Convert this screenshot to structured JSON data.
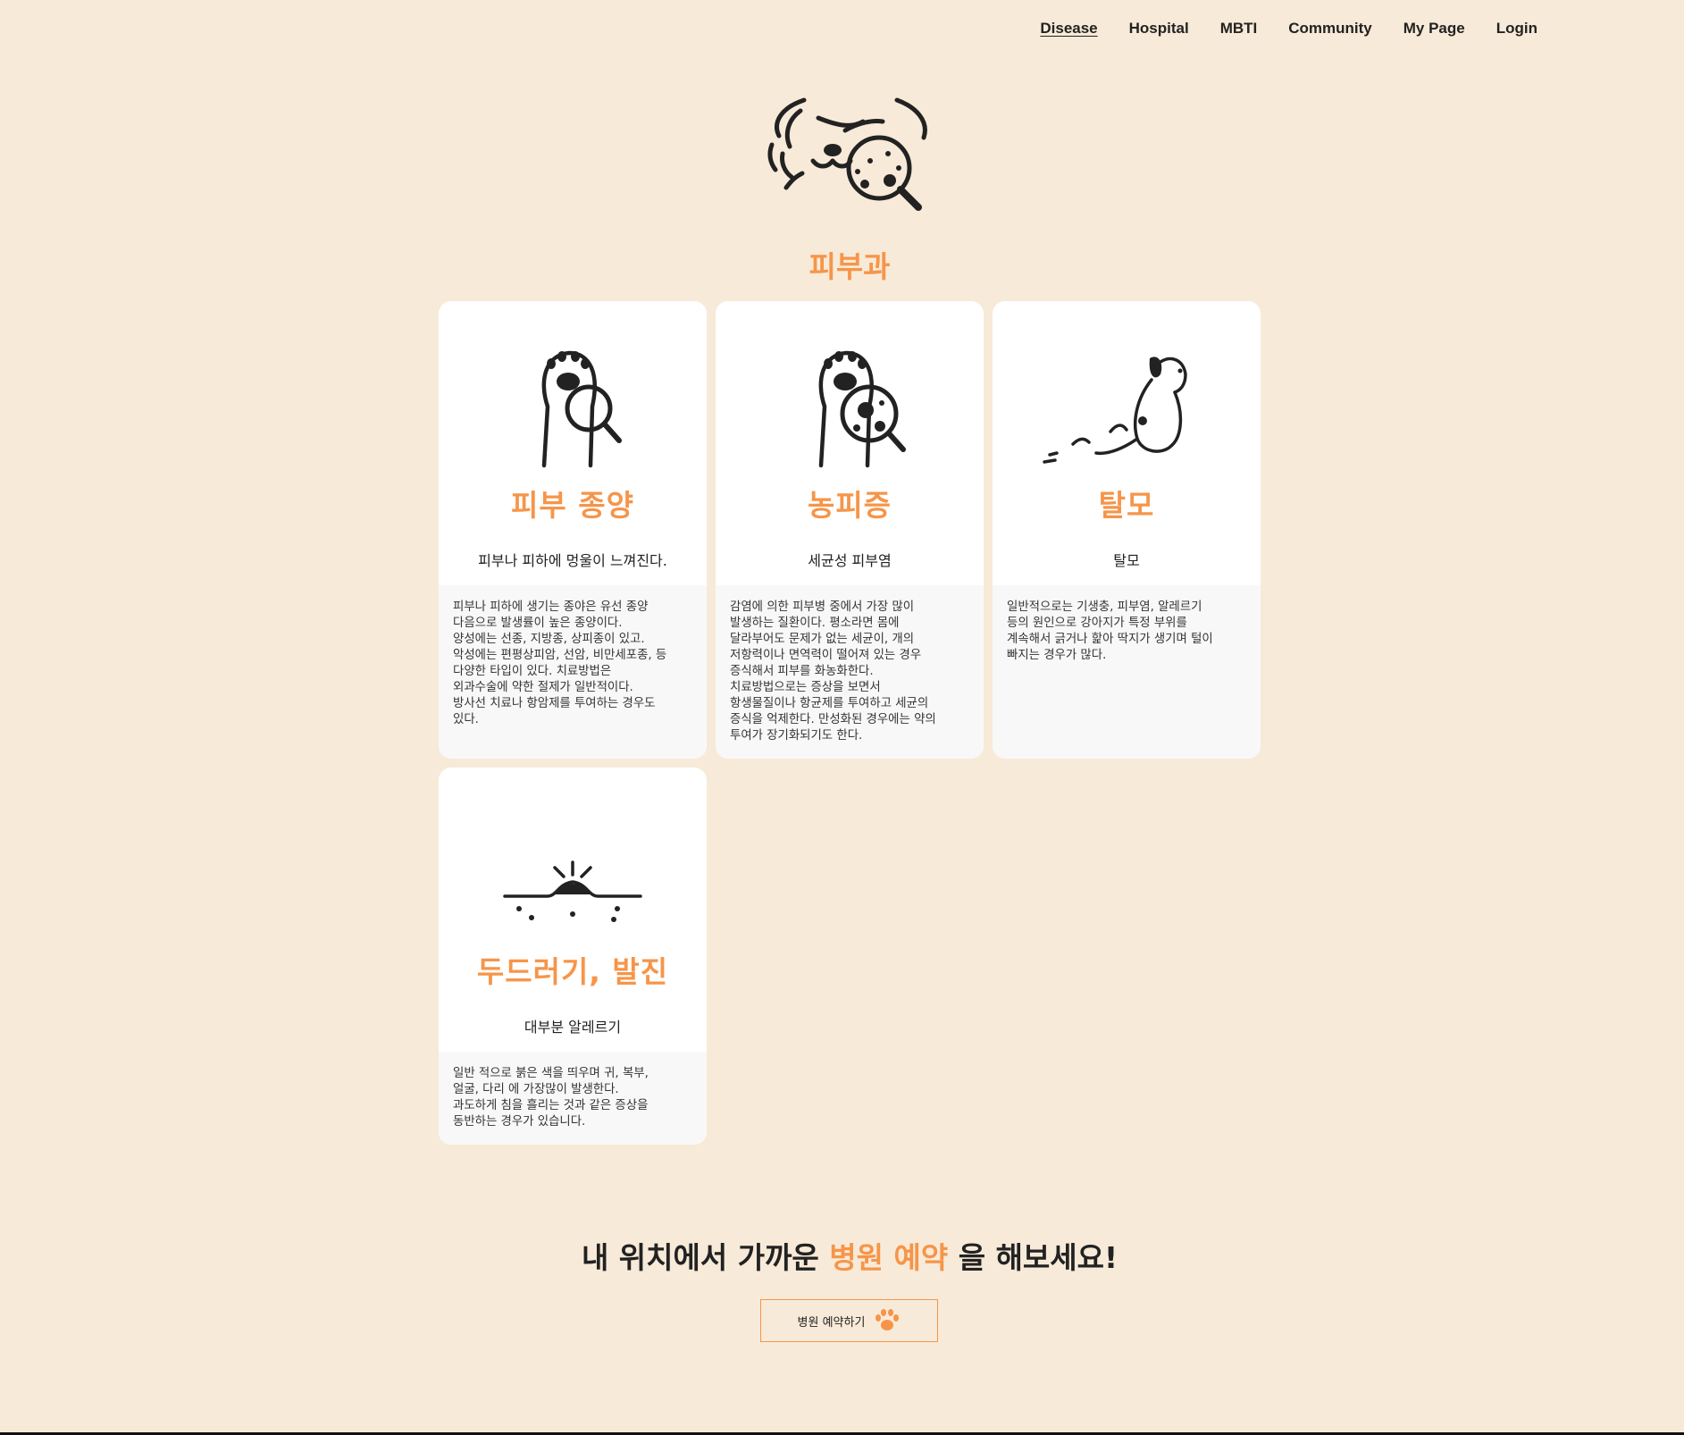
{
  "nav": {
    "items": [
      "Disease",
      "Hospital",
      "MBTI",
      "Community",
      "My Page",
      "Login"
    ]
  },
  "section_title": "피부과",
  "cards": [
    {
      "name": "피부 종양",
      "subtitle": "피부나 피하에 멍울이 느껴진다.",
      "description": "피부나 피하에 생기는 종야은 유선 종양\n다음으로 발생률이 높은 종양이다.\n양성에는 선종, 지방종, 상피종이 있고.\n악성에는 편평상피암, 선암, 비만세포종, 등\n다양한 타입이 있다. 치료방법은\n외과수술에 약한 절제가 일반적이다.\n방사선 치료나 항암제를 투여하는 경우도\n있다.",
      "icon": "paw-magnifier-icon"
    },
    {
      "name": "농피증",
      "subtitle": "세균성 피부염",
      "description": "감염에 의한 피부병 중에서 가장 많이\n발생하는 질환이다. 평소라면 몸에\n달라부어도 문제가 없는 세균이, 개의\n저항력이나 면역력이 떨어져 있는 경우\n증식해서 피부를 화농화한다.\n치료방법으로는 증상을 보면서\n항생물질이나 항균제를 투여하고 세균의\n증식을 억제한다. 만성화된 경우에는 약의\n투여가 장기화되기도 한다.",
      "icon": "paw-bacteria-icon"
    },
    {
      "name": "탈모",
      "subtitle": "탈모",
      "description": "일반적으로는 기생충, 피부염, 알레르기\n등의 원인으로 강아지가 특정 부위를\n계속해서 긁거나 핥아 딱지가 생기며 털이\n빠지는 경우가 많다.",
      "icon": "scratching-dog-icon"
    },
    {
      "name": "두드러기, 발진",
      "subtitle": "대부분 알레르기",
      "description": "일반 적으로 붉은 색을 띄우며 귀, 복부,\n얼굴, 다리 에 가장많이 발생한다.\n과도하게 침을 흘리는 것과 같은 증상을\n동반하는 경우가 있습니다.",
      "icon": "skin-bump-icon"
    }
  ],
  "cta": {
    "text_before": "내 위치에서 가까운 ",
    "highlight": "병원 예약",
    "text_after": " 을 해보세요!",
    "button_label": "병원 예약하기"
  },
  "colors": {
    "background": "#f8ead8",
    "accent": "#f69549",
    "card_bg": "#ffffff",
    "desc_bg": "#f8f8f8"
  }
}
